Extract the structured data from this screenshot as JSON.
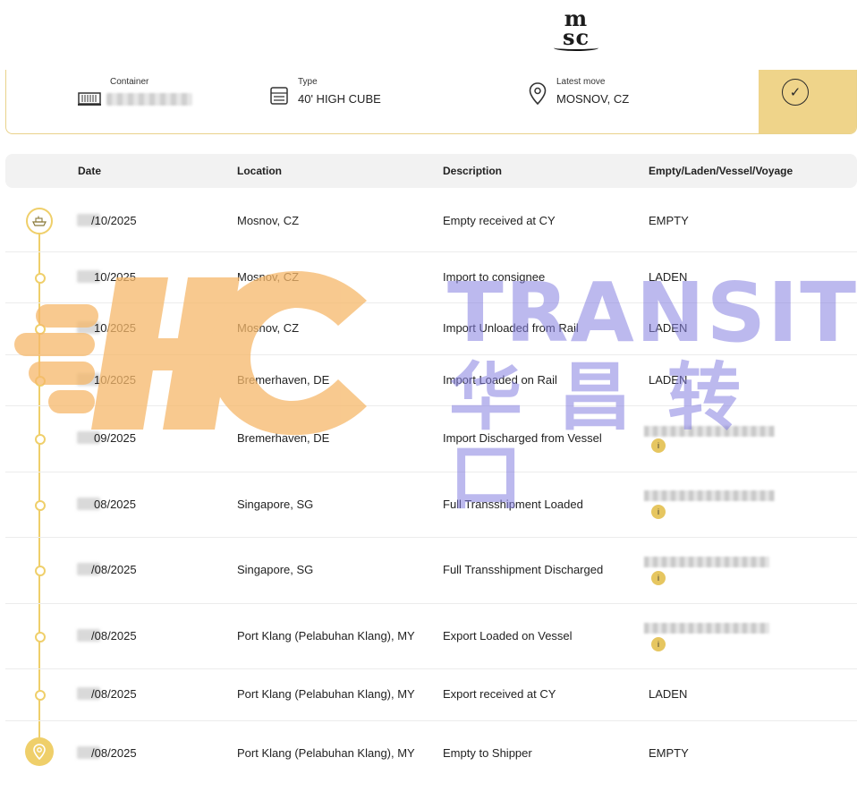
{
  "brand": {
    "logo_line1": "m",
    "logo_line2": "sc"
  },
  "summary": {
    "container_label": "Container",
    "type_label": "Type",
    "type_value": "40' HIGH CUBE",
    "latest_move_label": "Latest move",
    "latest_move_value": "MOSNOV, CZ",
    "status_icon": "check-circle-icon"
  },
  "table": {
    "headers": {
      "date": "Date",
      "location": "Location",
      "description": "Description",
      "vessel": "Empty/Laden/Vessel/Voyage"
    },
    "rows": [
      {
        "date": "/10/2025",
        "location": "Mosnov, CZ",
        "description": "Empty received at CY",
        "vessel": "EMPTY"
      },
      {
        "date": "10/2025",
        "location": "Mosnov, CZ",
        "description": "Import to consignee",
        "vessel": "LADEN"
      },
      {
        "date": "10/2025",
        "location": "Mosnov, CZ",
        "description": "Import Unloaded from Rail",
        "vessel": "LADEN"
      },
      {
        "date": "10/2025",
        "location": "Bremerhaven, DE",
        "description": "Import Loaded on Rail",
        "vessel": "LADEN"
      },
      {
        "date": "09/2025",
        "location": "Bremerhaven, DE",
        "description": "Import Discharged from Vessel",
        "vessel": ""
      },
      {
        "date": "08/2025",
        "location": "Singapore, SG",
        "description": "Full Transshipment Loaded",
        "vessel": ""
      },
      {
        "date": "/08/2025",
        "location": "Singapore, SG",
        "description": "Full Transshipment Discharged",
        "vessel": ""
      },
      {
        "date": "/08/2025",
        "location": "Port Klang (Pelabuhan Klang), MY",
        "description": "Export Loaded on Vessel",
        "vessel": ""
      },
      {
        "date": "/08/2025",
        "location": "Port Klang (Pelabuhan Klang), MY",
        "description": "Export received at CY",
        "vessel": "LADEN"
      },
      {
        "date": "/08/2025",
        "location": "Port Klang (Pelabuhan Klang), MY",
        "description": "Empty to Shipper",
        "vessel": "EMPTY"
      }
    ]
  },
  "watermark": {
    "latin": "TRANSIT",
    "chinese": "华昌转口"
  },
  "colors": {
    "accent": "#efcf6a",
    "panel": "#efd48a",
    "watermark_orange": "#f6b86a",
    "watermark_purple": "#8580e0"
  }
}
